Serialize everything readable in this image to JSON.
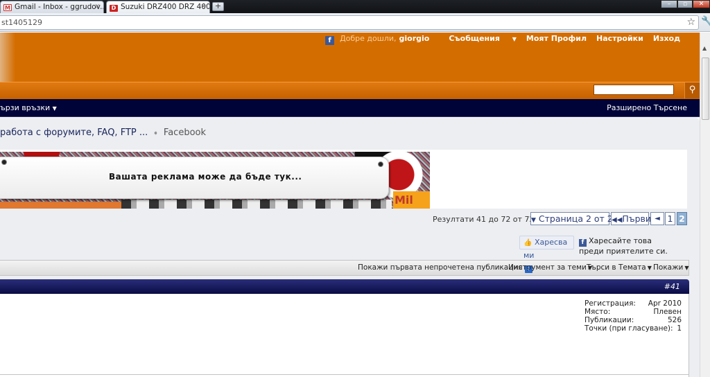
{
  "browser": {
    "tabs": [
      {
        "title": "Gmail - Inbox - ggrudov...",
        "favicon": "gmail-icon"
      },
      {
        "title": "Suzuki DRZ400 DRZ 400 E...",
        "favicon": "forum-icon"
      }
    ],
    "new_tab": "+",
    "url": "st1405129",
    "window_controls": [
      "minimize-icon",
      "maximize-icon",
      "close-icon"
    ]
  },
  "header": {
    "fb": "f",
    "welcome": "Добре дошли,",
    "username": "giorgio",
    "messages": "Съобщения",
    "profile": "Моят Профил",
    "settings": "Настройки",
    "logout": "Изход"
  },
  "nav": {
    "quick_links": "ързи връзки",
    "advanced_search": "Разширено Търсене"
  },
  "breadcrumb": {
    "parent": "работа с форумите, FAQ, FTP ...",
    "current": "Facebook"
  },
  "ad": {
    "text": "Вашата реклама може да бъде тук...",
    "brand_fragment": "Mil"
  },
  "pagination": {
    "results": "Резултати 41 до 72 от 72",
    "page_label": "Страница 2 от 2",
    "first": "Първи",
    "prev": "◄",
    "pages": [
      "1",
      "2"
    ],
    "current_page": "2"
  },
  "facebook": {
    "like_label": "Харесва ми",
    "note": "Харесайте това преди приятелите си."
  },
  "thread_tools": {
    "first_unread": "Покажи първата непрочетена публикация",
    "tools": "Инструмент за теми",
    "search": "Търси в Темата",
    "display": "Покажи"
  },
  "post": {
    "number": "#41",
    "user_info": [
      {
        "label": "Регистрация:",
        "value": "Apr 2010"
      },
      {
        "label": "Място:",
        "value": "Плевен"
      },
      {
        "label": "Публикации:",
        "value": "526"
      },
      {
        "label": "Точки (при гласуване):",
        "value": "1"
      }
    ]
  },
  "colors": {
    "header_orange": "#d46d00",
    "navbar_navy": "#000338",
    "post_header": "#0a0c45",
    "link_blue": "#2c3d7a"
  }
}
